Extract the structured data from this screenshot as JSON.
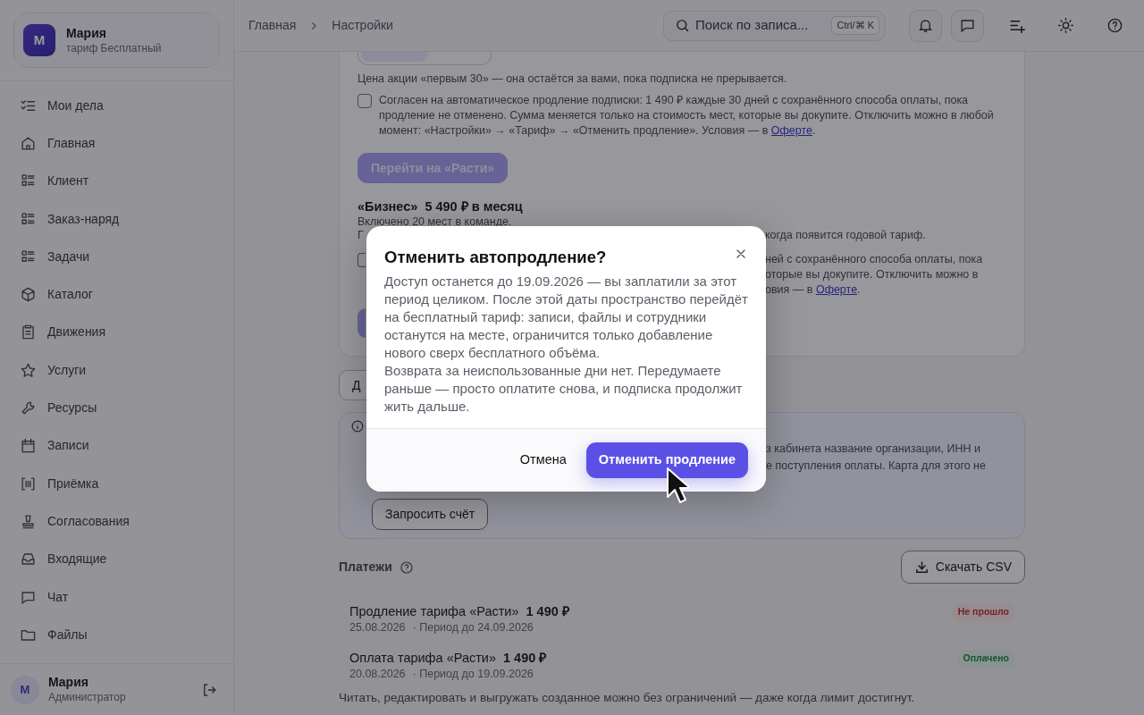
{
  "sidebar": {
    "account": {
      "avatar": "М",
      "name": "Мария",
      "plan": "тариф Бесплатный"
    },
    "items": [
      {
        "label": "Мои дела"
      },
      {
        "label": "Главная"
      },
      {
        "label": "Клиент"
      },
      {
        "label": "Заказ-наряд"
      },
      {
        "label": "Задачи"
      },
      {
        "label": "Каталог"
      },
      {
        "label": "Движения"
      },
      {
        "label": "Услуги"
      },
      {
        "label": "Ресурсы"
      },
      {
        "label": "Записи"
      },
      {
        "label": "Приёмка"
      },
      {
        "label": "Согласования"
      },
      {
        "label": "Входящие"
      },
      {
        "label": "Чат"
      },
      {
        "label": "Файлы"
      }
    ],
    "user": {
      "avatar": "М",
      "name": "Мария",
      "role": "Администратор"
    }
  },
  "topbar": {
    "breadcrumbs": [
      "Главная",
      "Настройки"
    ],
    "search": {
      "placeholder": "Поиск по записа...",
      "shortcut": "Ctrl/⌘ K"
    }
  },
  "plan_card": {
    "promo_note": "Цена акции «первым 30» — она остаётся за вами, пока подписка не прерывается.",
    "autorenew": {
      "checked": false,
      "text": "Согласен на автоматическое продление подписки: 1 490 ₽ каждые 30 дней с сохранённого способа оплаты, пока продление не отменено. Сумма меняется только на стоимость мест, которые вы докупите. Отключить можно в любой момент: «Настройки» → «Тариф» → «Отменить продление». Условия — в ",
      "link": "Оферте",
      "after": "."
    },
    "upgrade_button": {
      "label": "Перейти на «Расти»",
      "disabled": true
    },
    "business": {
      "name": "«Бизнес»",
      "price": "5 490 ₽ в месяц",
      "included": "Включено 20 мест в команде.",
      "note_start": "Г",
      "note_end": "когда появится годовой тариф.",
      "autorenew": {
        "lines": [
          "ней с сохранённого способа оплаты, пока",
          "оторые вы докупите. Отключить можно в"
        ],
        "last": "овия — в ",
        "link": "Оферте",
        "after": "."
      }
    }
  },
  "outline_button": {
    "label": "Д"
  },
  "invoice_card": {
    "lines": [
      "з кабинета название организации, ИНН и",
      "е поступления оплаты. Карта для этого не"
    ],
    "button": "Запросить счёт"
  },
  "payments": {
    "title": "Платежи",
    "download": "Скачать CSV",
    "rows": [
      {
        "title": "Продление тарифа «Расти»",
        "amount": "1 490 ₽",
        "date": "25.08.2026",
        "period": "· Период до 24.09.2026",
        "status": "Не прошло",
        "kind": "failed"
      },
      {
        "title": "Оплата тарифа «Расти»",
        "amount": "1 490 ₽",
        "date": "20.08.2026",
        "period": "· Период до 19.09.2026",
        "status": "Оплачено",
        "kind": "paid"
      }
    ]
  },
  "footer_note": "Читать, редактировать и выгружать созданное можно без ограничений — даже когда лимит достигнут.",
  "dialog": {
    "title": "Отменить автопродление?",
    "paragraphs": [
      "Доступ останется до 19.09.2026 — вы заплатили за этот период целиком. После этой даты пространство перейдёт на бесплатный тариф: записи, файлы и сотрудники останутся на месте, ограничится только добавление нового сверх бесплатного объёма.",
      "Возврата за неиспользованные дни нет. Передумаете раньше — просто оплатите снова, и подписка продолжит жить дальше."
    ],
    "buttons": [
      {
        "label": "Отмена",
        "kind": "secondary"
      },
      {
        "label": "Отменить продление",
        "kind": "primary"
      }
    ]
  }
}
